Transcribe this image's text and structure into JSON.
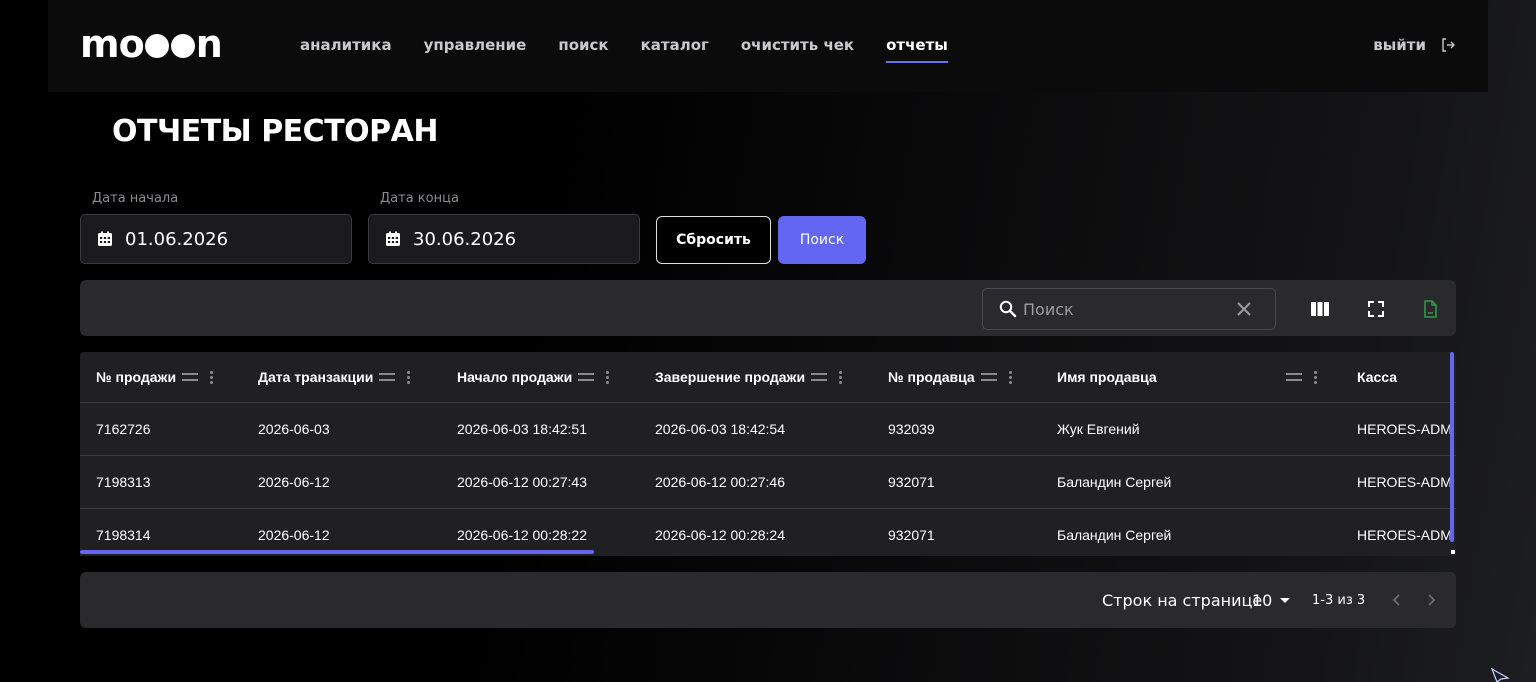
{
  "app": {
    "logo": [
      "mo",
      "n"
    ],
    "nav": [
      {
        "label": "аналитика",
        "active": false
      },
      {
        "label": "управление",
        "active": false
      },
      {
        "label": "поиск",
        "active": false
      },
      {
        "label": "каталог",
        "active": false
      },
      {
        "label": "очистить чек",
        "active": false
      },
      {
        "label": "отчеты",
        "active": true
      }
    ],
    "logout_label": "выйти"
  },
  "page": {
    "title": "ОТЧЕТЫ РЕСТОРАН"
  },
  "filters": {
    "start_label": "Дата начала",
    "start_value": "01.06.2026",
    "end_label": "Дата конца",
    "end_value": "30.06.2026",
    "reset_label": "Сбросить",
    "search_label": "Поиск"
  },
  "toolbar": {
    "search_placeholder": "Поиск"
  },
  "table": {
    "columns": [
      {
        "label": "№ продажи",
        "sortable": true
      },
      {
        "label": "Дата транзакции",
        "sortable": true
      },
      {
        "label": "Начало продажи",
        "sortable": true
      },
      {
        "label": "Завершение продажи",
        "sortable": true
      },
      {
        "label": "№ продавца",
        "sortable": true
      },
      {
        "label": "Имя продавца",
        "sortable": true
      },
      {
        "label": "Касса",
        "sortable": false
      }
    ],
    "rows": [
      [
        "7162726",
        "2026-06-03",
        "2026-06-03 18:42:51",
        "2026-06-03 18:42:54",
        "932039",
        "Жук Евгений",
        "HEROES-ADM"
      ],
      [
        "7198313",
        "2026-06-12",
        "2026-06-12 00:27:43",
        "2026-06-12 00:27:46",
        "932071",
        "Баландин Сергей",
        "HEROES-ADM"
      ],
      [
        "7198314",
        "2026-06-12",
        "2026-06-12 00:28:22",
        "2026-06-12 00:28:24",
        "932071",
        "Баландин Сергей",
        "HEROES-ADM"
      ]
    ]
  },
  "pagination": {
    "rows_per_page_label": "Строк на странице",
    "rows_per_page_value": "10",
    "range_label": "1-3 из 3"
  },
  "colors": {
    "accent": "#6266f1",
    "export_icon": "#2e9b4f"
  }
}
